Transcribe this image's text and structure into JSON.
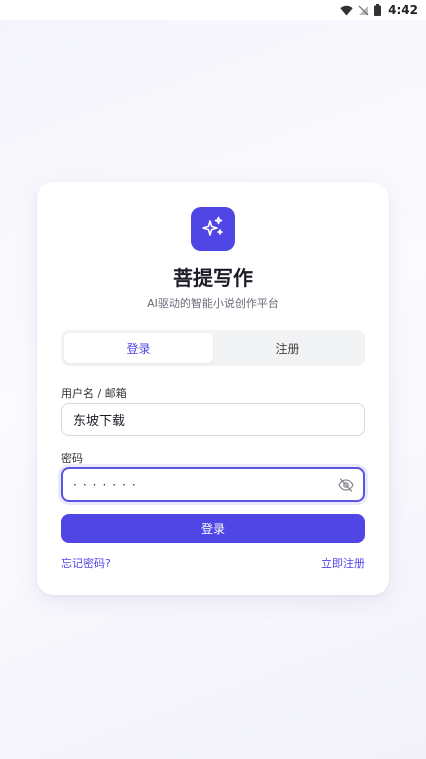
{
  "status_bar": {
    "time": "4:42"
  },
  "app": {
    "name": "菩提写作",
    "tagline": "AI驱动的智能小说创作平台"
  },
  "tabs": [
    {
      "label": "登录",
      "active": true
    },
    {
      "label": "注册",
      "active": false
    }
  ],
  "form": {
    "username_label": "用户名 / 邮箱",
    "username_value": "东坡下载",
    "password_label": "密码",
    "password_mask": "·······",
    "submit_label": "登录"
  },
  "links": {
    "forgot_password": "忘记密码?",
    "register_now": "立即注册"
  },
  "colors": {
    "accent": "#4f46e5",
    "background": "#f6f6fc"
  },
  "icons": {
    "logo": "sparkles-icon",
    "password_toggle": "eye-off-icon"
  }
}
